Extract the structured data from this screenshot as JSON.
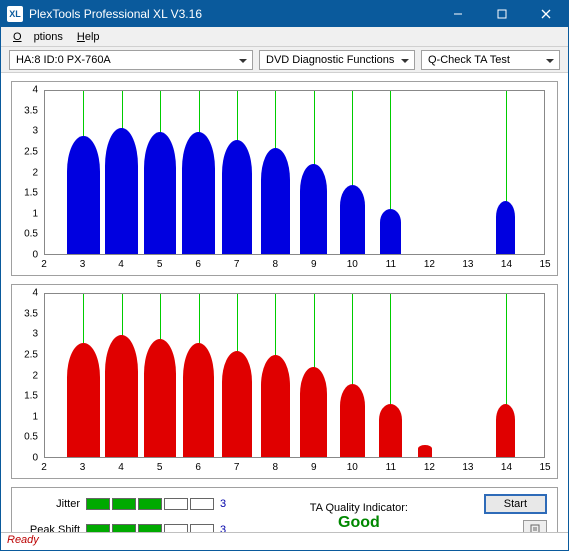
{
  "window": {
    "title": "PlexTools Professional XL V3.16",
    "icon_text": "XL"
  },
  "menubar": {
    "options": "Options",
    "help": "Help"
  },
  "toolbar": {
    "device": "HA:8 ID:0   PX-760A",
    "mode": "DVD Diagnostic Functions",
    "test": "Q-Check TA Test"
  },
  "chart_data": [
    {
      "type": "area",
      "color": "#0000e0",
      "xlabel": "",
      "ylabel": "",
      "xlim": [
        2,
        15
      ],
      "ylim": [
        0,
        4
      ],
      "xticks": [
        2,
        3,
        4,
        5,
        6,
        7,
        8,
        9,
        10,
        11,
        12,
        13,
        14,
        15
      ],
      "yticks": [
        0,
        0.5,
        1,
        1.5,
        2,
        2.5,
        3,
        3.5,
        4
      ],
      "gridlines_x": [
        3,
        4,
        5,
        6,
        7,
        8,
        9,
        10,
        11,
        14
      ],
      "peaks": [
        {
          "x": 3,
          "h": 2.9,
          "w": 0.85
        },
        {
          "x": 4,
          "h": 3.1,
          "w": 0.85
        },
        {
          "x": 5,
          "h": 3.0,
          "w": 0.85
        },
        {
          "x": 6,
          "h": 3.0,
          "w": 0.85
        },
        {
          "x": 7,
          "h": 2.8,
          "w": 0.8
        },
        {
          "x": 8,
          "h": 2.6,
          "w": 0.75
        },
        {
          "x": 9,
          "h": 2.2,
          "w": 0.7
        },
        {
          "x": 10,
          "h": 1.7,
          "w": 0.65
        },
        {
          "x": 11,
          "h": 1.1,
          "w": 0.55
        },
        {
          "x": 14,
          "h": 1.3,
          "w": 0.5
        }
      ]
    },
    {
      "type": "area",
      "color": "#e00000",
      "xlabel": "",
      "ylabel": "",
      "xlim": [
        2,
        15
      ],
      "ylim": [
        0,
        4
      ],
      "xticks": [
        2,
        3,
        4,
        5,
        6,
        7,
        8,
        9,
        10,
        11,
        12,
        13,
        14,
        15
      ],
      "yticks": [
        0,
        0.5,
        1,
        1.5,
        2,
        2.5,
        3,
        3.5,
        4
      ],
      "gridlines_x": [
        3,
        4,
        5,
        6,
        7,
        8,
        9,
        10,
        11,
        14
      ],
      "peaks": [
        {
          "x": 3,
          "h": 2.8,
          "w": 0.85
        },
        {
          "x": 4,
          "h": 3.0,
          "w": 0.85
        },
        {
          "x": 5,
          "h": 2.9,
          "w": 0.85
        },
        {
          "x": 6,
          "h": 2.8,
          "w": 0.8
        },
        {
          "x": 7,
          "h": 2.6,
          "w": 0.8
        },
        {
          "x": 8,
          "h": 2.5,
          "w": 0.75
        },
        {
          "x": 9,
          "h": 2.2,
          "w": 0.7
        },
        {
          "x": 10,
          "h": 1.8,
          "w": 0.65
        },
        {
          "x": 11,
          "h": 1.3,
          "w": 0.6
        },
        {
          "x": 11.9,
          "h": 0.3,
          "w": 0.35
        },
        {
          "x": 14,
          "h": 1.3,
          "w": 0.5
        }
      ]
    }
  ],
  "meters": {
    "jitter": {
      "label": "Jitter",
      "filled": 3,
      "total": 5,
      "value": "3"
    },
    "peak_shift": {
      "label": "Peak Shift",
      "filled": 3,
      "total": 5,
      "value": "3"
    }
  },
  "ta_quality": {
    "label": "TA Quality Indicator:",
    "value": "Good"
  },
  "buttons": {
    "start": "Start"
  },
  "status": "Ready"
}
